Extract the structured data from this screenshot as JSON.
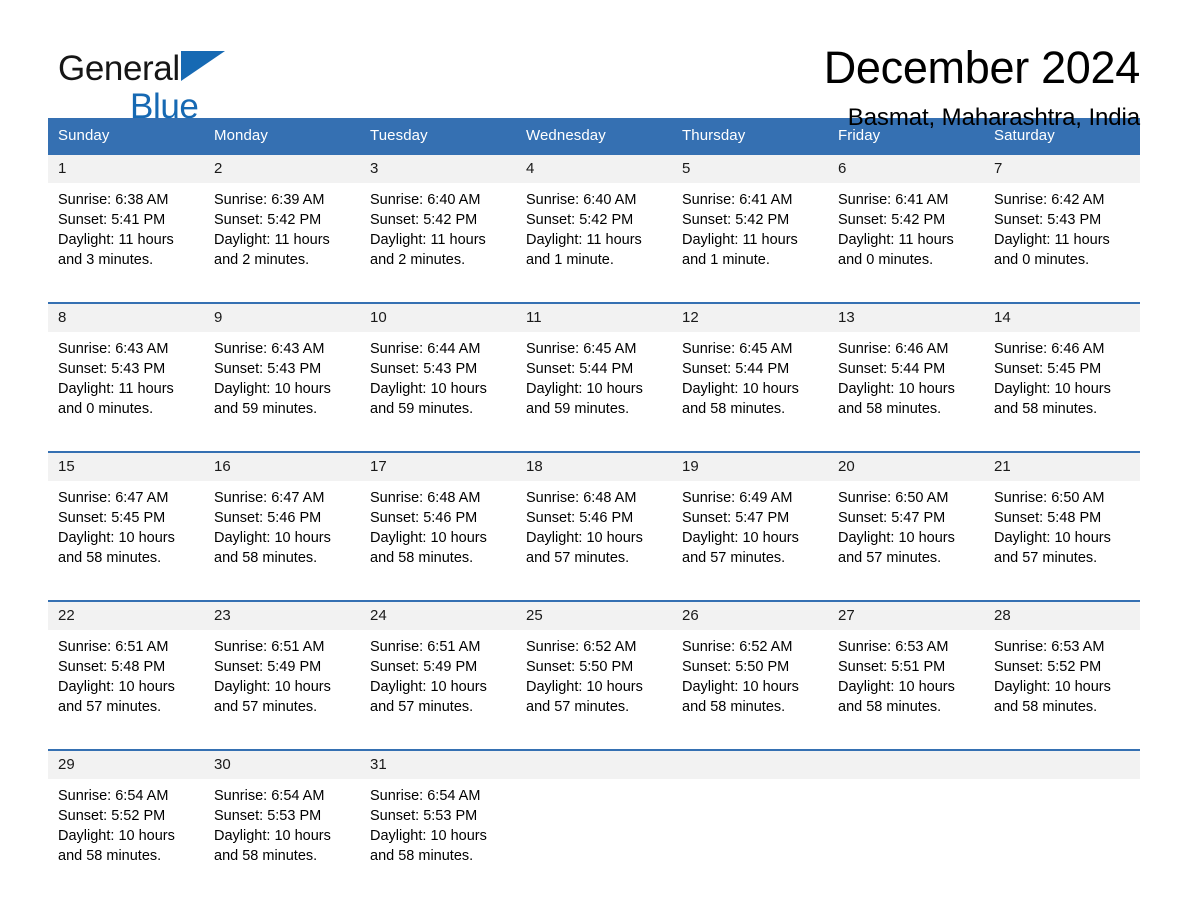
{
  "brand": {
    "name_part1": "General",
    "name_part2": "Blue",
    "triangle_color": "#1669b3",
    "logo_icon": "triangle-icon"
  },
  "header": {
    "month_title": "December 2024",
    "location": "Basmat, Maharashtra, India"
  },
  "theme": {
    "header_blue": "#3570b2",
    "daynum_band": "#f2f2f2",
    "brand_blue": "#1669b3"
  },
  "weekdays": [
    "Sunday",
    "Monday",
    "Tuesday",
    "Wednesday",
    "Thursday",
    "Friday",
    "Saturday"
  ],
  "weeks": [
    {
      "days": [
        {
          "num": "1",
          "l1": "Sunrise: 6:38 AM",
          "l2": "Sunset: 5:41 PM",
          "l3": "Daylight: 11 hours",
          "l4": "and 3 minutes."
        },
        {
          "num": "2",
          "l1": "Sunrise: 6:39 AM",
          "l2": "Sunset: 5:42 PM",
          "l3": "Daylight: 11 hours",
          "l4": "and 2 minutes."
        },
        {
          "num": "3",
          "l1": "Sunrise: 6:40 AM",
          "l2": "Sunset: 5:42 PM",
          "l3": "Daylight: 11 hours",
          "l4": "and 2 minutes."
        },
        {
          "num": "4",
          "l1": "Sunrise: 6:40 AM",
          "l2": "Sunset: 5:42 PM",
          "l3": "Daylight: 11 hours",
          "l4": "and 1 minute."
        },
        {
          "num": "5",
          "l1": "Sunrise: 6:41 AM",
          "l2": "Sunset: 5:42 PM",
          "l3": "Daylight: 11 hours",
          "l4": "and 1 minute."
        },
        {
          "num": "6",
          "l1": "Sunrise: 6:41 AM",
          "l2": "Sunset: 5:42 PM",
          "l3": "Daylight: 11 hours",
          "l4": "and 0 minutes."
        },
        {
          "num": "7",
          "l1": "Sunrise: 6:42 AM",
          "l2": "Sunset: 5:43 PM",
          "l3": "Daylight: 11 hours",
          "l4": "and 0 minutes."
        }
      ]
    },
    {
      "days": [
        {
          "num": "8",
          "l1": "Sunrise: 6:43 AM",
          "l2": "Sunset: 5:43 PM",
          "l3": "Daylight: 11 hours",
          "l4": "and 0 minutes."
        },
        {
          "num": "9",
          "l1": "Sunrise: 6:43 AM",
          "l2": "Sunset: 5:43 PM",
          "l3": "Daylight: 10 hours",
          "l4": "and 59 minutes."
        },
        {
          "num": "10",
          "l1": "Sunrise: 6:44 AM",
          "l2": "Sunset: 5:43 PM",
          "l3": "Daylight: 10 hours",
          "l4": "and 59 minutes."
        },
        {
          "num": "11",
          "l1": "Sunrise: 6:45 AM",
          "l2": "Sunset: 5:44 PM",
          "l3": "Daylight: 10 hours",
          "l4": "and 59 minutes."
        },
        {
          "num": "12",
          "l1": "Sunrise: 6:45 AM",
          "l2": "Sunset: 5:44 PM",
          "l3": "Daylight: 10 hours",
          "l4": "and 58 minutes."
        },
        {
          "num": "13",
          "l1": "Sunrise: 6:46 AM",
          "l2": "Sunset: 5:44 PM",
          "l3": "Daylight: 10 hours",
          "l4": "and 58 minutes."
        },
        {
          "num": "14",
          "l1": "Sunrise: 6:46 AM",
          "l2": "Sunset: 5:45 PM",
          "l3": "Daylight: 10 hours",
          "l4": "and 58 minutes."
        }
      ]
    },
    {
      "days": [
        {
          "num": "15",
          "l1": "Sunrise: 6:47 AM",
          "l2": "Sunset: 5:45 PM",
          "l3": "Daylight: 10 hours",
          "l4": "and 58 minutes."
        },
        {
          "num": "16",
          "l1": "Sunrise: 6:47 AM",
          "l2": "Sunset: 5:46 PM",
          "l3": "Daylight: 10 hours",
          "l4": "and 58 minutes."
        },
        {
          "num": "17",
          "l1": "Sunrise: 6:48 AM",
          "l2": "Sunset: 5:46 PM",
          "l3": "Daylight: 10 hours",
          "l4": "and 58 minutes."
        },
        {
          "num": "18",
          "l1": "Sunrise: 6:48 AM",
          "l2": "Sunset: 5:46 PM",
          "l3": "Daylight: 10 hours",
          "l4": "and 57 minutes."
        },
        {
          "num": "19",
          "l1": "Sunrise: 6:49 AM",
          "l2": "Sunset: 5:47 PM",
          "l3": "Daylight: 10 hours",
          "l4": "and 57 minutes."
        },
        {
          "num": "20",
          "l1": "Sunrise: 6:50 AM",
          "l2": "Sunset: 5:47 PM",
          "l3": "Daylight: 10 hours",
          "l4": "and 57 minutes."
        },
        {
          "num": "21",
          "l1": "Sunrise: 6:50 AM",
          "l2": "Sunset: 5:48 PM",
          "l3": "Daylight: 10 hours",
          "l4": "and 57 minutes."
        }
      ]
    },
    {
      "days": [
        {
          "num": "22",
          "l1": "Sunrise: 6:51 AM",
          "l2": "Sunset: 5:48 PM",
          "l3": "Daylight: 10 hours",
          "l4": "and 57 minutes."
        },
        {
          "num": "23",
          "l1": "Sunrise: 6:51 AM",
          "l2": "Sunset: 5:49 PM",
          "l3": "Daylight: 10 hours",
          "l4": "and 57 minutes."
        },
        {
          "num": "24",
          "l1": "Sunrise: 6:51 AM",
          "l2": "Sunset: 5:49 PM",
          "l3": "Daylight: 10 hours",
          "l4": "and 57 minutes."
        },
        {
          "num": "25",
          "l1": "Sunrise: 6:52 AM",
          "l2": "Sunset: 5:50 PM",
          "l3": "Daylight: 10 hours",
          "l4": "and 57 minutes."
        },
        {
          "num": "26",
          "l1": "Sunrise: 6:52 AM",
          "l2": "Sunset: 5:50 PM",
          "l3": "Daylight: 10 hours",
          "l4": "and 58 minutes."
        },
        {
          "num": "27",
          "l1": "Sunrise: 6:53 AM",
          "l2": "Sunset: 5:51 PM",
          "l3": "Daylight: 10 hours",
          "l4": "and 58 minutes."
        },
        {
          "num": "28",
          "l1": "Sunrise: 6:53 AM",
          "l2": "Sunset: 5:52 PM",
          "l3": "Daylight: 10 hours",
          "l4": "and 58 minutes."
        }
      ]
    },
    {
      "days": [
        {
          "num": "29",
          "l1": "Sunrise: 6:54 AM",
          "l2": "Sunset: 5:52 PM",
          "l3": "Daylight: 10 hours",
          "l4": "and 58 minutes."
        },
        {
          "num": "30",
          "l1": "Sunrise: 6:54 AM",
          "l2": "Sunset: 5:53 PM",
          "l3": "Daylight: 10 hours",
          "l4": "and 58 minutes."
        },
        {
          "num": "31",
          "l1": "Sunrise: 6:54 AM",
          "l2": "Sunset: 5:53 PM",
          "l3": "Daylight: 10 hours",
          "l4": "and 58 minutes."
        },
        {
          "num": "",
          "l1": "",
          "l2": "",
          "l3": "",
          "l4": ""
        },
        {
          "num": "",
          "l1": "",
          "l2": "",
          "l3": "",
          "l4": ""
        },
        {
          "num": "",
          "l1": "",
          "l2": "",
          "l3": "",
          "l4": ""
        },
        {
          "num": "",
          "l1": "",
          "l2": "",
          "l3": "",
          "l4": ""
        }
      ]
    }
  ]
}
